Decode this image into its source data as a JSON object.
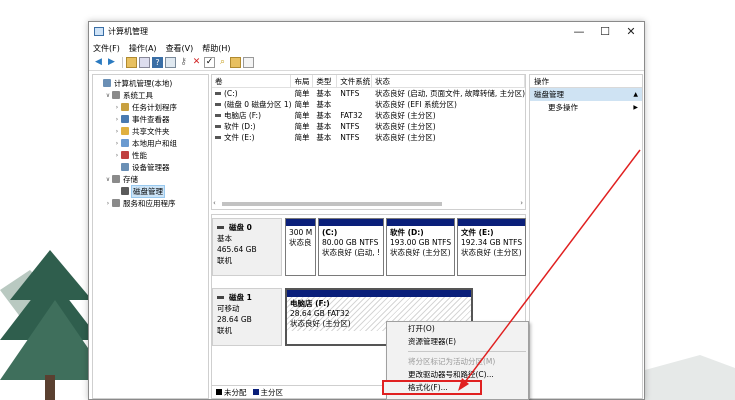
{
  "window": {
    "title": "计算机管理",
    "minimize": "—",
    "maximize": "☐",
    "close": "✕"
  },
  "menu": [
    "文件(F)",
    "操作(A)",
    "查看(V)",
    "帮助(H)"
  ],
  "tree": [
    {
      "label": "计算机管理(本地)",
      "icon": "computer-icon",
      "arrow": "",
      "indent": 0,
      "color": "#6a8fb5"
    },
    {
      "label": "系统工具",
      "icon": "tools-icon",
      "arrow": "∨",
      "indent": 1,
      "color": "#8a8a8a"
    },
    {
      "label": "任务计划程序",
      "icon": "clock-icon",
      "arrow": "›",
      "indent": 2,
      "color": "#c8a040"
    },
    {
      "label": "事件查看器",
      "icon": "event-icon",
      "arrow": "›",
      "indent": 2,
      "color": "#4a7ab0"
    },
    {
      "label": "共享文件夹",
      "icon": "folder-icon",
      "arrow": "›",
      "indent": 2,
      "color": "#e0b040"
    },
    {
      "label": "本地用户和组",
      "icon": "users-icon",
      "arrow": "›",
      "indent": 2,
      "color": "#6a9ad0"
    },
    {
      "label": "性能",
      "icon": "performance-icon",
      "arrow": "›",
      "indent": 2,
      "color": "#c04040"
    },
    {
      "label": "设备管理器",
      "icon": "device-icon",
      "arrow": "",
      "indent": 2,
      "color": "#6a8fb5"
    },
    {
      "label": "存储",
      "icon": "storage-icon",
      "arrow": "∨",
      "indent": 1,
      "color": "#8a8a8a"
    },
    {
      "label": "磁盘管理",
      "icon": "disk-icon",
      "arrow": "",
      "indent": 2,
      "color": "#5a5a5a",
      "selected": true
    },
    {
      "label": "服务和应用程序",
      "icon": "services-icon",
      "arrow": "›",
      "indent": 1,
      "color": "#8a8a8a"
    }
  ],
  "volume_table": {
    "headers": [
      "卷",
      "布局",
      "类型",
      "文件系统",
      "状态"
    ],
    "rows": [
      [
        "(C:)",
        "简单",
        "基本",
        "NTFS",
        "状态良好 (启动, 页面文件, 故障转储, 主分区)"
      ],
      [
        "(磁盘 0 磁盘分区 1)",
        "简单",
        "基本",
        "",
        "状态良好 (EFI 系统分区)"
      ],
      [
        "电脑店 (F:)",
        "简单",
        "基本",
        "FAT32",
        "状态良好 (主分区)"
      ],
      [
        "软件 (D:)",
        "简单",
        "基本",
        "NTFS",
        "状态良好 (主分区)"
      ],
      [
        "文件 (E:)",
        "简单",
        "基本",
        "NTFS",
        "状态良好 (主分区)"
      ]
    ]
  },
  "disks": [
    {
      "name": "磁盘 0",
      "type": "基本",
      "size": "465.64 GB",
      "status": "联机",
      "partitions": [
        {
          "name": "",
          "size": "300 M",
          "status": "状态良"
        },
        {
          "name": "(C:)",
          "size": "80.00 GB NTFS",
          "status": "状态良好 (启动, !"
        },
        {
          "name": "软件 (D:)",
          "size": "193.00 GB NTFS",
          "status": "状态良好 (主分区)"
        },
        {
          "name": "文件 (E:)",
          "size": "192.34 GB NTFS",
          "status": "状态良好 (主分区)"
        }
      ]
    },
    {
      "name": "磁盘 1",
      "type": "可移动",
      "size": "28.64 GB",
      "status": "联机",
      "partitions": [
        {
          "name": "电脑店 (F:)",
          "size": "28.64 GB FAT32",
          "status": "状态良好 (主分区)"
        }
      ]
    }
  ],
  "legend": [
    {
      "label": "未分配",
      "color": "#000000"
    },
    {
      "label": "主分区",
      "color": "#0a1f7a"
    }
  ],
  "actions": {
    "header": "操作",
    "section": "磁盘管理",
    "more": "更多操作"
  },
  "context_menu": {
    "items": [
      {
        "label": "打开(O)",
        "disabled": false
      },
      {
        "label": "资源管理器(E)",
        "disabled": false
      },
      {
        "sep": true
      },
      {
        "label": "将分区标记为活动分区(M)",
        "disabled": true
      },
      {
        "label": "更改驱动器号和路径(C)...",
        "disabled": false
      },
      {
        "label": "格式化(F)...",
        "disabled": false,
        "highlight": true
      }
    ]
  },
  "colors": {
    "partition_cap": "#0a1f7a",
    "selection": "#cce4f7",
    "highlight_red": "#e02020"
  }
}
